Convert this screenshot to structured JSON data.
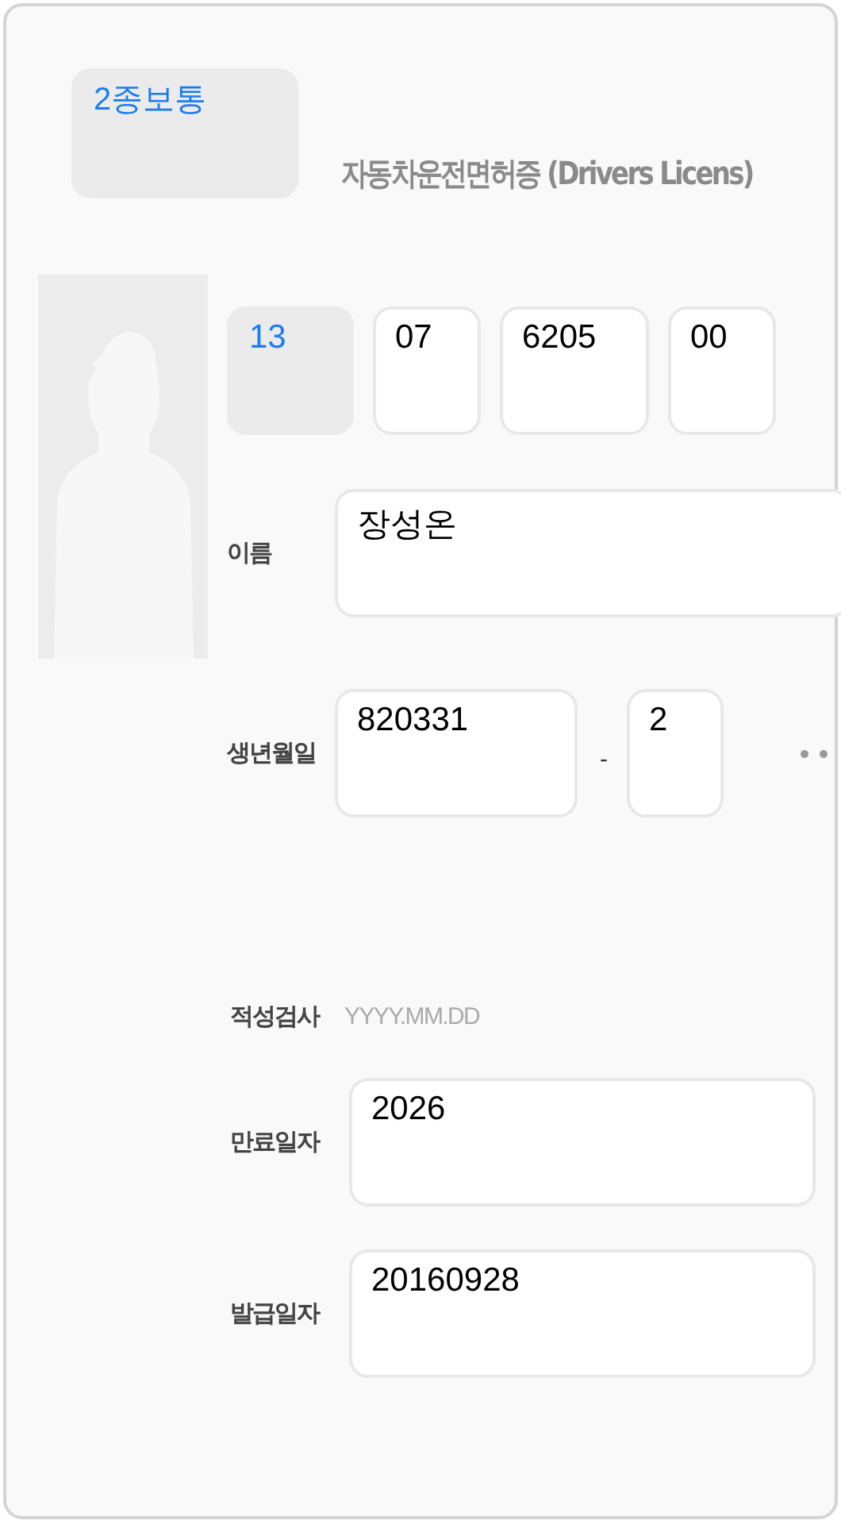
{
  "license_type": {
    "value": "2종보통"
  },
  "title": "자동차운전면허증 (Drivers Licens)",
  "license_number": [
    {
      "value": "13",
      "kind": "select"
    },
    {
      "value": "07",
      "kind": "text"
    },
    {
      "value": "6205",
      "kind": "text"
    },
    {
      "value": "00",
      "kind": "text"
    }
  ],
  "name": {
    "label": "이름",
    "value": "장성온"
  },
  "birth": {
    "label": "생년월일",
    "value": "820331",
    "separator": "-",
    "gender": "2"
  },
  "aptitude_test": {
    "label": "적성검사",
    "placeholder": "YYYY.MM.DD"
  },
  "expiry": {
    "label": "만료일자",
    "value": "2026"
  },
  "issue_date": {
    "label": "발급일자",
    "value": "20160928"
  }
}
